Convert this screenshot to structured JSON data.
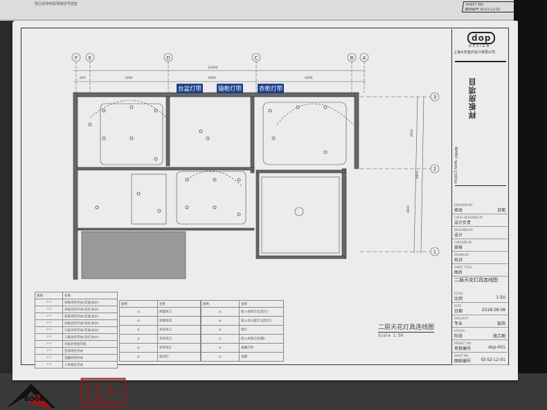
{
  "previous_page": {
    "legend_text": "独立有线电视/网络信号插座",
    "sheet_no_label": "SHEET NO.",
    "sheet_no": "图纸编号 ID-S1-L2-01"
  },
  "title_block": {
    "logo": "dop",
    "logo_sub": "DESIGN",
    "company": "上海大朴室内设计有限公司",
    "project_title": "样板房项目",
    "project_name_label": "PROJECT NAME 工程名称",
    "rows": [
      {
        "en": "REVISION NO",
        "cn": "修改",
        "en2": "DATE",
        "value": "日期"
      },
      {
        "en": "CHLEF DESIGNED BY",
        "cn": "设计负责",
        "value": ""
      },
      {
        "en": "DESIGNED BY",
        "cn": "设计",
        "value": ""
      },
      {
        "en": "CHECKED BY",
        "cn": "审核",
        "value": ""
      },
      {
        "en": "DRAWN BY",
        "cn": "校对",
        "value": ""
      },
      {
        "en": "SHEET TITLE",
        "cn": "图名",
        "value": ""
      }
    ],
    "sheet_title": "二层天花灯具连线图",
    "rows2": [
      {
        "en": "SCALE",
        "cn": "比例",
        "value": "1:50"
      },
      {
        "en": "DATE",
        "cn": "日期",
        "value": "2018.08.08"
      },
      {
        "en": "SPECIALTY",
        "cn": "专业",
        "value": "装饰"
      },
      {
        "en": "STATUS",
        "cn": "阶段",
        "value": "施工图"
      },
      {
        "en": "PROJECT NO",
        "cn": "项目编号",
        "value": "dop-001"
      },
      {
        "en": "SHEET NO",
        "cn": "图纸编号",
        "value": "ID-S2-L2-01"
      }
    ]
  },
  "plan": {
    "axes_top": [
      "F",
      "E",
      "D",
      "C",
      "B",
      "A"
    ],
    "axes_right": [
      "3",
      "2",
      "1"
    ],
    "dims_top_total": "12000",
    "dims_top": [
      "600",
      "3300",
      "3600",
      "4500"
    ],
    "dims_right": [
      "3000",
      "3600"
    ],
    "dims_right_total": "6600",
    "tags": [
      "台盆灯带",
      "镜柜灯带",
      "衣柜灯带"
    ],
    "tag_color": "#1d3f8a"
  },
  "legend_left": {
    "headers": [
      "图例",
      "名称"
    ],
    "rows": [
      "单极单控开关(普通,防水)",
      "单极双控开关(双控,防水)",
      "双极单控开关(普通,防水)",
      "双极双控开关(双控,防水)",
      "三极单控开关(普通,防水)",
      "三极双控开关(双控,防水)",
      "可视对讲室内机",
      "空调温控开关",
      "浴霸控制开关",
      "人体感应开关"
    ]
  },
  "legend_mid": {
    "headers": [
      "图例",
      "名称"
    ],
    "rows": [
      "侧面风口",
      "侧面排风",
      "条形风口",
      "条形风口",
      "装饰吊灯",
      "吸顶灯"
    ]
  },
  "legend_right": {
    "headers": [
      "图例",
      "名称"
    ],
    "rows": [
      "嵌入式射灯(应急灯)",
      "嵌入式斗胆灯(应急灯)",
      "壁灯",
      "嵌入式筒灯(防雾)",
      "隐藏灯带",
      "浴霸"
    ]
  },
  "drawing_title": "二层天花灯具连线图",
  "drawing_scale": "Scale 1:50",
  "watermark": {
    "text": "BOOK",
    "color": "#8b1a1a"
  }
}
